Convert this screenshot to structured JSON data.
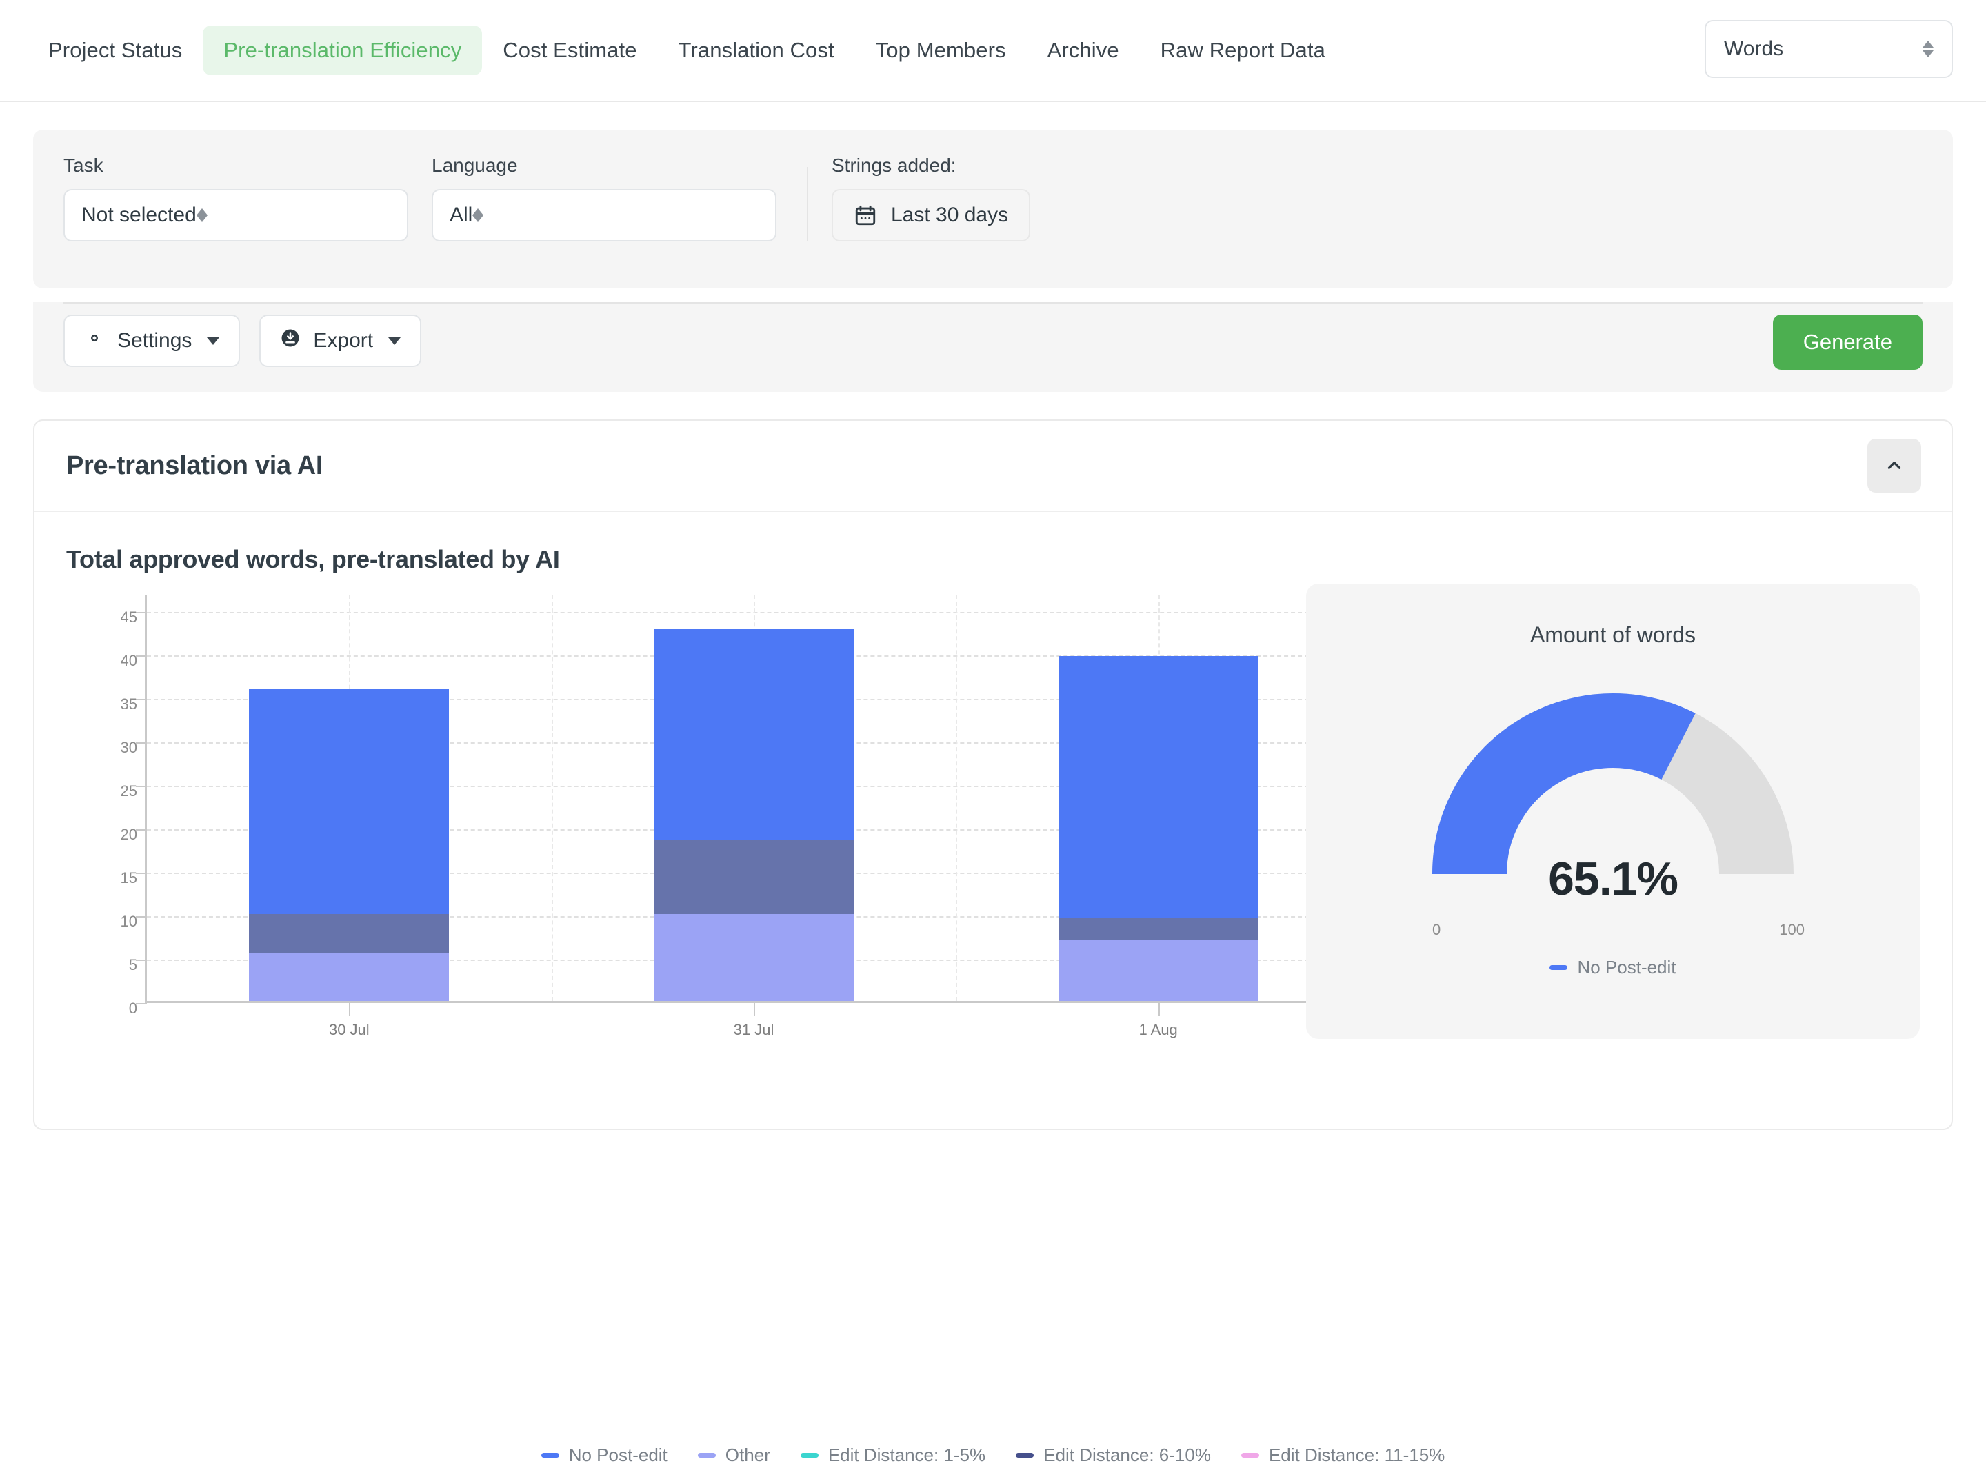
{
  "nav": {
    "tabs": [
      {
        "label": "Project Status",
        "active": false
      },
      {
        "label": "Pre-translation Efficiency",
        "active": true
      },
      {
        "label": "Cost Estimate",
        "active": false
      },
      {
        "label": "Translation Cost",
        "active": false
      },
      {
        "label": "Top Members",
        "active": false
      },
      {
        "label": "Archive",
        "active": false
      },
      {
        "label": "Raw Report Data",
        "active": false
      }
    ],
    "unit_select": {
      "value": "Words"
    }
  },
  "filters": {
    "task": {
      "label": "Task",
      "value": "Not selected"
    },
    "language": {
      "label": "Language",
      "value": "All"
    },
    "strings_added": {
      "label": "Strings added:",
      "value": "Last 30 days"
    }
  },
  "actions": {
    "settings_label": "Settings",
    "export_label": "Export",
    "generate_label": "Generate"
  },
  "report": {
    "title": "Pre-translation via AI",
    "chart_title": "Total approved words, pre-translated by AI"
  },
  "colors": {
    "no_post_edit": "#4d78f5",
    "other": "#9ba3f5",
    "edit_1_5": "#3bd5cf",
    "edit_6_10": "#46508c",
    "edit_11_15": "#f0a7e8",
    "segment_other": "#9ba3f5",
    "segment_6_10": "#6673ab",
    "gauge_fill": "#4d78f5",
    "gauge_track": "#dedede",
    "accent_green": "#4caf50",
    "tab_active_text": "#5bb96a",
    "tab_active_bg": "#e8f6ea"
  },
  "chart_data": {
    "type": "bar",
    "title": "Total approved words, pre-translated by AI",
    "stacked": true,
    "categories": [
      "30 Jul",
      "31 Jul",
      "1 Aug"
    ],
    "xlabel": "",
    "ylabel": "",
    "ylim": [
      0,
      47
    ],
    "yticks": [
      0,
      5,
      10,
      15,
      20,
      25,
      30,
      35,
      40,
      45
    ],
    "grid": true,
    "legend_position": "bottom",
    "series": [
      {
        "name": "Other",
        "color": "#9ba3f5",
        "values": [
          5.5,
          10,
          7
        ]
      },
      {
        "name": "Edit Distance: 6-10%",
        "color": "#6673ab",
        "values": [
          4.5,
          8.5,
          2.5
        ]
      },
      {
        "name": "No Post-edit",
        "color": "#4d78f5",
        "values": [
          26,
          24.3,
          30.2
        ]
      },
      {
        "name": "Edit Distance: 1-5%",
        "color": "#3bd5cf",
        "values": [
          0,
          0,
          0
        ]
      },
      {
        "name": "Edit Distance: 11-15%",
        "color": "#f0a7e8",
        "values": [
          0,
          0,
          0
        ]
      }
    ],
    "totals": [
      36,
      42.8,
      39.7
    ],
    "legend": [
      {
        "label": "No Post-edit",
        "color": "#4d78f5"
      },
      {
        "label": "Other",
        "color": "#9ba3f5"
      },
      {
        "label": "Edit Distance: 1-5%",
        "color": "#3bd5cf"
      },
      {
        "label": "Edit Distance: 6-10%",
        "color": "#46508c"
      },
      {
        "label": "Edit Distance: 11-15%",
        "color": "#f0a7e8"
      }
    ]
  },
  "gauge": {
    "type": "gauge",
    "title": "Amount of words",
    "value_label": "65.1%",
    "value": 65.1,
    "min_label": "0",
    "max_label": "100",
    "min": 0,
    "max": 100,
    "legend_label": "No Post-edit"
  }
}
